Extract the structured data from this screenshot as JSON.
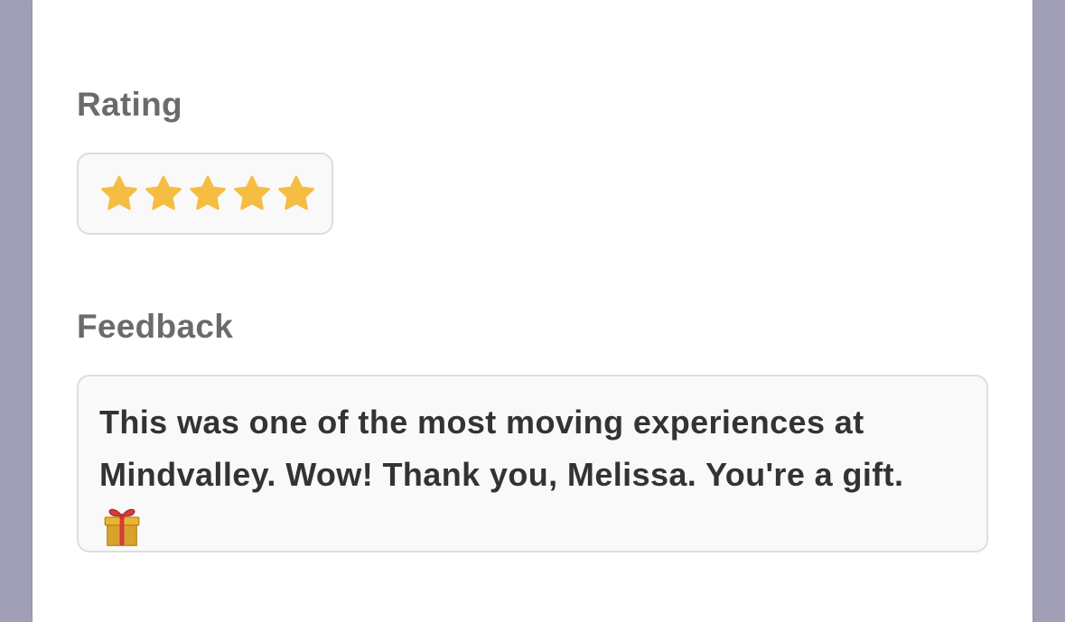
{
  "rating": {
    "label": "Rating",
    "value": 5,
    "max": 5,
    "star_color": "#f5bd41"
  },
  "feedback": {
    "label": "Feedback",
    "text": "This was one of the most moving experiences at Mindvalley. Wow! Thank you, Melissa. You're a gift.",
    "emoji_icon": "gift-icon"
  },
  "colors": {
    "backdrop": "#a19eb8",
    "panel": "#ffffff",
    "field_background": "#f9f9f9",
    "field_border": "#dedede",
    "label_text": "#6b6b6b",
    "body_text": "#333333"
  }
}
